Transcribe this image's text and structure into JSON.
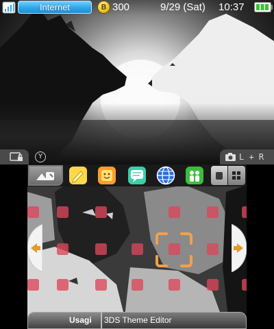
{
  "top_screen": {
    "status_bar": {
      "connection_label": "Internet",
      "coin_symbol": "B",
      "coin_count": "300",
      "date": "9/29 (Sat)",
      "time": "10:37",
      "icons": {
        "wifi": "wifi-signal-icon",
        "coin": "play-coin-icon",
        "battery": "battery-icon"
      },
      "colors": {
        "internet_pill": "#2fa6e8",
        "battery_fill": "#33c633"
      }
    },
    "wallpaper": "wolves-moon-wallpaper",
    "bottom_controls": {
      "y_label": "Y",
      "l_plus_r": "L + R",
      "icons": [
        "camera-lock-icon",
        "camera-icon"
      ]
    }
  },
  "bottom_screen": {
    "app_tray": {
      "settings_icon": "settings-wrench-icon",
      "apps": [
        "notes-pencil-icon",
        "smiley-face-icon",
        "chat-bubble-icon",
        "globe-browser-icon",
        "people-icon"
      ],
      "view_icons": [
        "single-view-icon",
        "grid-view-icon"
      ]
    },
    "grid": {
      "slot_color": "#dc465a",
      "selection_color": "#f2a14b",
      "selected_slot_index": 6
    },
    "footer": {
      "username": "Usagi",
      "title": "3DS Theme Editor"
    }
  }
}
